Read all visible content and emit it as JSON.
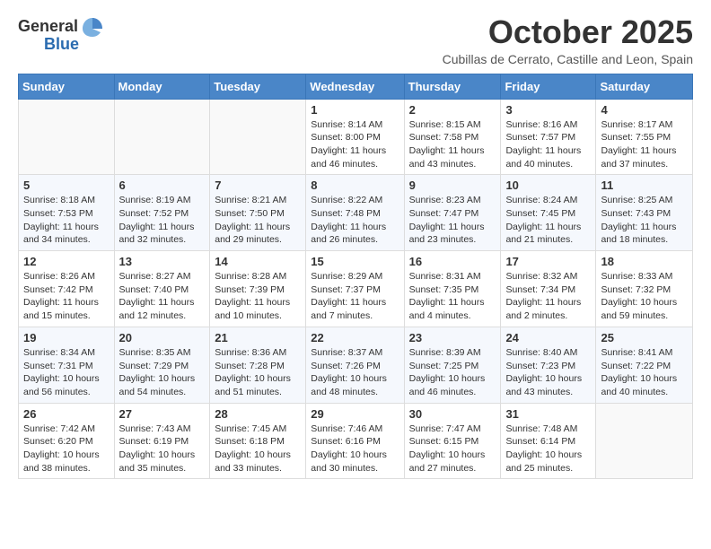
{
  "header": {
    "logo_general": "General",
    "logo_blue": "Blue",
    "month_title": "October 2025",
    "subtitle": "Cubillas de Cerrato, Castille and Leon, Spain"
  },
  "weekdays": [
    "Sunday",
    "Monday",
    "Tuesday",
    "Wednesday",
    "Thursday",
    "Friday",
    "Saturday"
  ],
  "weeks": [
    [
      {
        "day": "",
        "info": ""
      },
      {
        "day": "",
        "info": ""
      },
      {
        "day": "",
        "info": ""
      },
      {
        "day": "1",
        "info": "Sunrise: 8:14 AM\nSunset: 8:00 PM\nDaylight: 11 hours and 46 minutes."
      },
      {
        "day": "2",
        "info": "Sunrise: 8:15 AM\nSunset: 7:58 PM\nDaylight: 11 hours and 43 minutes."
      },
      {
        "day": "3",
        "info": "Sunrise: 8:16 AM\nSunset: 7:57 PM\nDaylight: 11 hours and 40 minutes."
      },
      {
        "day": "4",
        "info": "Sunrise: 8:17 AM\nSunset: 7:55 PM\nDaylight: 11 hours and 37 minutes."
      }
    ],
    [
      {
        "day": "5",
        "info": "Sunrise: 8:18 AM\nSunset: 7:53 PM\nDaylight: 11 hours and 34 minutes."
      },
      {
        "day": "6",
        "info": "Sunrise: 8:19 AM\nSunset: 7:52 PM\nDaylight: 11 hours and 32 minutes."
      },
      {
        "day": "7",
        "info": "Sunrise: 8:21 AM\nSunset: 7:50 PM\nDaylight: 11 hours and 29 minutes."
      },
      {
        "day": "8",
        "info": "Sunrise: 8:22 AM\nSunset: 7:48 PM\nDaylight: 11 hours and 26 minutes."
      },
      {
        "day": "9",
        "info": "Sunrise: 8:23 AM\nSunset: 7:47 PM\nDaylight: 11 hours and 23 minutes."
      },
      {
        "day": "10",
        "info": "Sunrise: 8:24 AM\nSunset: 7:45 PM\nDaylight: 11 hours and 21 minutes."
      },
      {
        "day": "11",
        "info": "Sunrise: 8:25 AM\nSunset: 7:43 PM\nDaylight: 11 hours and 18 minutes."
      }
    ],
    [
      {
        "day": "12",
        "info": "Sunrise: 8:26 AM\nSunset: 7:42 PM\nDaylight: 11 hours and 15 minutes."
      },
      {
        "day": "13",
        "info": "Sunrise: 8:27 AM\nSunset: 7:40 PM\nDaylight: 11 hours and 12 minutes."
      },
      {
        "day": "14",
        "info": "Sunrise: 8:28 AM\nSunset: 7:39 PM\nDaylight: 11 hours and 10 minutes."
      },
      {
        "day": "15",
        "info": "Sunrise: 8:29 AM\nSunset: 7:37 PM\nDaylight: 11 hours and 7 minutes."
      },
      {
        "day": "16",
        "info": "Sunrise: 8:31 AM\nSunset: 7:35 PM\nDaylight: 11 hours and 4 minutes."
      },
      {
        "day": "17",
        "info": "Sunrise: 8:32 AM\nSunset: 7:34 PM\nDaylight: 11 hours and 2 minutes."
      },
      {
        "day": "18",
        "info": "Sunrise: 8:33 AM\nSunset: 7:32 PM\nDaylight: 10 hours and 59 minutes."
      }
    ],
    [
      {
        "day": "19",
        "info": "Sunrise: 8:34 AM\nSunset: 7:31 PM\nDaylight: 10 hours and 56 minutes."
      },
      {
        "day": "20",
        "info": "Sunrise: 8:35 AM\nSunset: 7:29 PM\nDaylight: 10 hours and 54 minutes."
      },
      {
        "day": "21",
        "info": "Sunrise: 8:36 AM\nSunset: 7:28 PM\nDaylight: 10 hours and 51 minutes."
      },
      {
        "day": "22",
        "info": "Sunrise: 8:37 AM\nSunset: 7:26 PM\nDaylight: 10 hours and 48 minutes."
      },
      {
        "day": "23",
        "info": "Sunrise: 8:39 AM\nSunset: 7:25 PM\nDaylight: 10 hours and 46 minutes."
      },
      {
        "day": "24",
        "info": "Sunrise: 8:40 AM\nSunset: 7:23 PM\nDaylight: 10 hours and 43 minutes."
      },
      {
        "day": "25",
        "info": "Sunrise: 8:41 AM\nSunset: 7:22 PM\nDaylight: 10 hours and 40 minutes."
      }
    ],
    [
      {
        "day": "26",
        "info": "Sunrise: 7:42 AM\nSunset: 6:20 PM\nDaylight: 10 hours and 38 minutes."
      },
      {
        "day": "27",
        "info": "Sunrise: 7:43 AM\nSunset: 6:19 PM\nDaylight: 10 hours and 35 minutes."
      },
      {
        "day": "28",
        "info": "Sunrise: 7:45 AM\nSunset: 6:18 PM\nDaylight: 10 hours and 33 minutes."
      },
      {
        "day": "29",
        "info": "Sunrise: 7:46 AM\nSunset: 6:16 PM\nDaylight: 10 hours and 30 minutes."
      },
      {
        "day": "30",
        "info": "Sunrise: 7:47 AM\nSunset: 6:15 PM\nDaylight: 10 hours and 27 minutes."
      },
      {
        "day": "31",
        "info": "Sunrise: 7:48 AM\nSunset: 6:14 PM\nDaylight: 10 hours and 25 minutes."
      },
      {
        "day": "",
        "info": ""
      }
    ]
  ]
}
